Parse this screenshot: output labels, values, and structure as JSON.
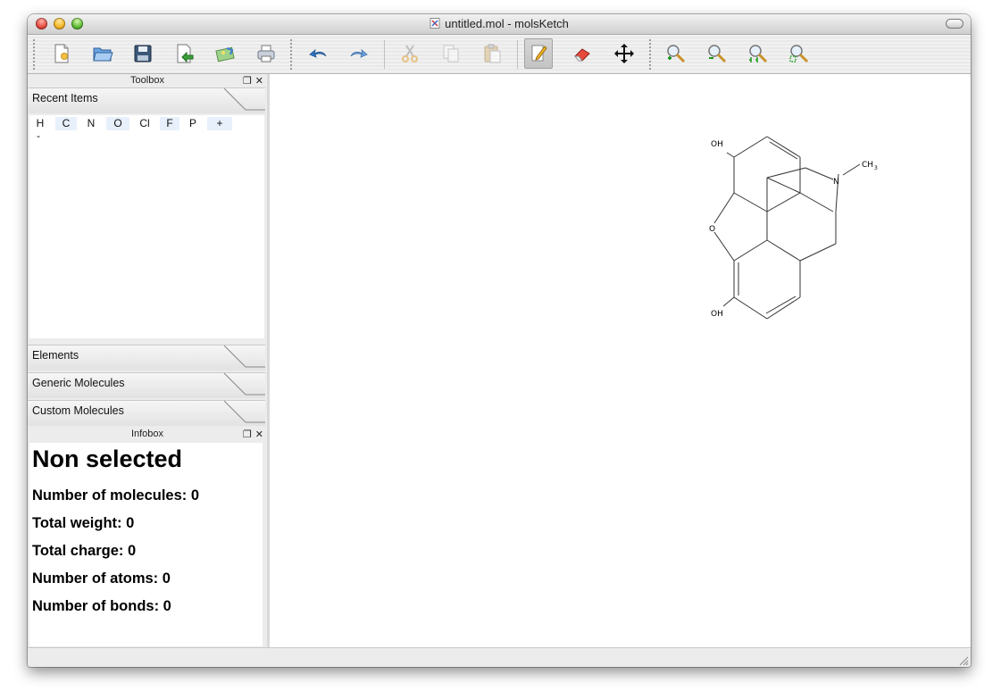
{
  "window": {
    "title": "untitled.mol - molsKetch"
  },
  "toolbar": {
    "buttons": [
      "new-file",
      "open-file",
      "save-file",
      "import",
      "export-image",
      "print",
      "undo",
      "redo",
      "cut",
      "copy",
      "paste",
      "draw-pencil",
      "eraser",
      "move",
      "zoom-in",
      "zoom-out",
      "zoom-1-1",
      "zoom-fit"
    ],
    "active": "draw-pencil"
  },
  "toolbox": {
    "title": "Toolbox",
    "recent_items_tab": "Recent Items",
    "elements_tab": "Elements",
    "generic_molecules_tab": "Generic Molecules",
    "custom_molecules_tab": "Custom Molecules",
    "recent_items": [
      "H",
      "C",
      "N",
      "O",
      "Cl",
      "F",
      "P",
      "+",
      "-"
    ]
  },
  "infobox": {
    "title": "Infobox",
    "heading": "Non selected",
    "molecules": "Number of molecules: 0",
    "weight": "Total weight: 0",
    "charge": "Total charge: 0",
    "atoms": "Number of atoms: 0",
    "bonds": "Number of bonds: 0"
  },
  "canvas": {
    "atom_labels": {
      "oh_top": "OH",
      "n": "N",
      "ch3": "CH",
      "ch3_sub": "3",
      "o": "O",
      "oh_bottom": "OH"
    }
  },
  "colors": {
    "active_tool_bg": "#c8c8c8",
    "panel_bg": "#ececec",
    "recent_item_shade": "#e8f0fb"
  }
}
